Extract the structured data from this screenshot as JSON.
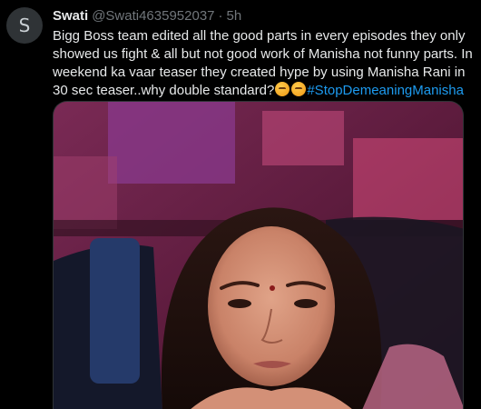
{
  "tweet": {
    "avatar_letter": "S",
    "display_name": "Swati",
    "handle": "@Swati4635952037",
    "separator": "·",
    "time": "5h",
    "text_main": "Bigg Boss team edited all the good parts in every episodes they only showed us fight & all but not good work of Manisha not funny parts. In weekend ka vaar teaser they created hype by using Manisha Rani in 30 sec teaser..why double standard?",
    "emojis": [
      "angry-face-emoji",
      "angry-face-emoji"
    ],
    "hashtag": "#StopDemeaningManisha"
  },
  "colors": {
    "background": "#000000",
    "text": "#e7e9ea",
    "secondary_text": "#71767b",
    "link": "#1d9bf0"
  }
}
